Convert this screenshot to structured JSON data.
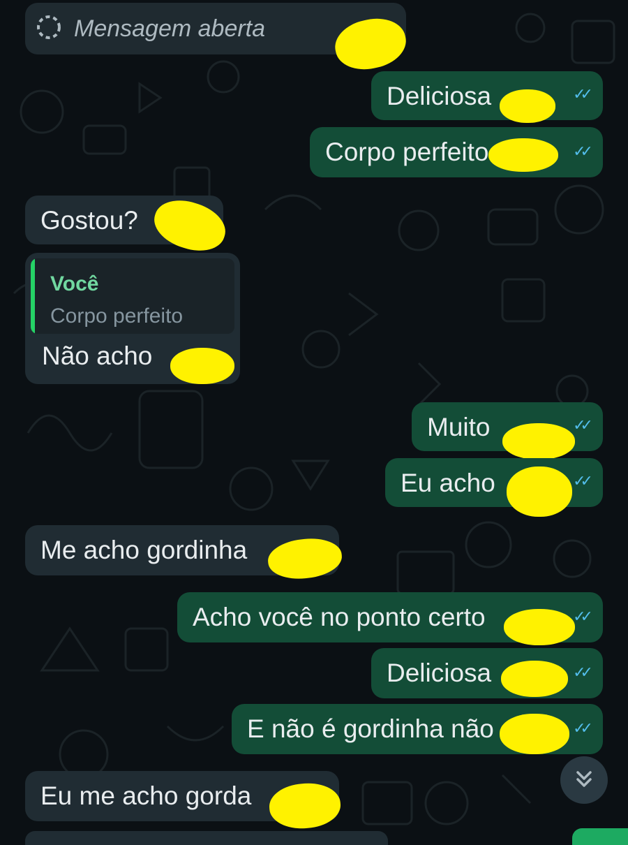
{
  "chat": {
    "view_once_label": "Mensagem aberta",
    "messages": [
      {
        "dir": "out",
        "text": "Deliciosa"
      },
      {
        "dir": "out",
        "text": "Corpo perfeito"
      },
      {
        "dir": "in",
        "text": "Gostou?"
      },
      {
        "dir": "in",
        "text": "Não acho",
        "reply_to": {
          "author": "Você",
          "text": "Corpo perfeito"
        }
      },
      {
        "dir": "out",
        "text": "Muito"
      },
      {
        "dir": "out",
        "text": "Eu acho"
      },
      {
        "dir": "in",
        "text": "Me acho gordinha"
      },
      {
        "dir": "out",
        "text": "Acho você no ponto certo"
      },
      {
        "dir": "out",
        "text": "Deliciosa"
      },
      {
        "dir": "out",
        "text": "E não é gordinha não"
      },
      {
        "dir": "in",
        "text": "Eu me acho gorda"
      }
    ]
  },
  "icons": {
    "view_once": "view-once-icon",
    "read_ticks": "double-check-icon",
    "scroll_down": "chevron-double-down-icon"
  },
  "colors": {
    "background": "#0b1014",
    "incoming_bubble": "#202c33",
    "outgoing_bubble": "#134d37",
    "read_ticks": "#53bdeb",
    "redaction": "#fff200",
    "quote_author": "#71d8a0"
  }
}
